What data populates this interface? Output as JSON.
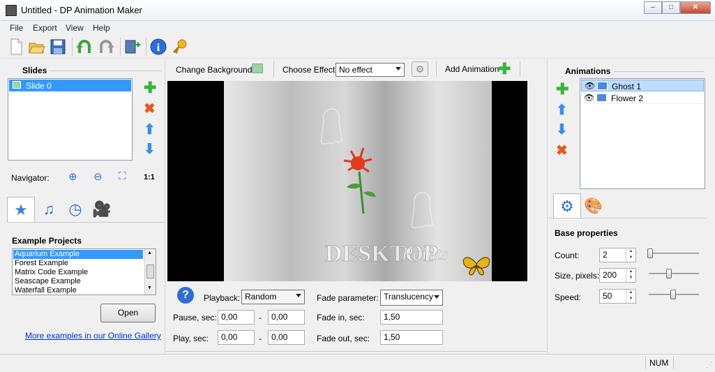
{
  "window": {
    "title": "Untitled - DP Animation Maker"
  },
  "menu": [
    "File",
    "Export",
    "View",
    "Help"
  ],
  "toolbar_icons": [
    "new-icon",
    "open-icon",
    "save-icon",
    "undo-icon",
    "redo-icon",
    "export-movie-icon",
    "info-icon",
    "key-icon"
  ],
  "slides": {
    "title": "Slides",
    "items": [
      "Slide 0"
    ],
    "navigator_label": "Navigator:",
    "zoom_label": "1:1"
  },
  "projects": {
    "title": "Example Projects",
    "items": [
      "Aquarium Example",
      "Forest Example",
      "Matrix Code Example",
      "Seascape Example",
      "Waterfall Example"
    ],
    "open_label": "Open",
    "gallery_link": "More examples in our Online Gallery"
  },
  "canvas_toolbar": {
    "change_background": "Change Background",
    "choose_effect_label": "Choose Effect:",
    "effect_value": "No effect",
    "add_animation": "Add Animation"
  },
  "scene": {
    "watermark_1": "DESKTOP",
    "watermark_2": "Paints"
  },
  "playback": {
    "playback_label": "Playback:",
    "playback_value": "Random",
    "pause_label": "Pause, sec:",
    "pause_from": "0,00",
    "pause_to": "0,00",
    "play_label": "Play, sec:",
    "play_from": "0,00",
    "play_to": "0,00",
    "dash": "-",
    "fade_param_label": "Fade parameter:",
    "fade_param_value": "Translucency",
    "fade_in_label": "Fade in, sec:",
    "fade_in_value": "1,50",
    "fade_out_label": "Fade out, sec:",
    "fade_out_value": "1,50"
  },
  "animations": {
    "title": "Animations",
    "items": [
      "Ghost 1",
      "Flower 2"
    ]
  },
  "base_props": {
    "title": "Base properties",
    "count_label": "Count:",
    "count_value": "2",
    "size_label": "Size, pixels:",
    "size_value": "200",
    "speed_label": "Speed:",
    "speed_value": "50"
  },
  "status": {
    "num": "NUM"
  }
}
